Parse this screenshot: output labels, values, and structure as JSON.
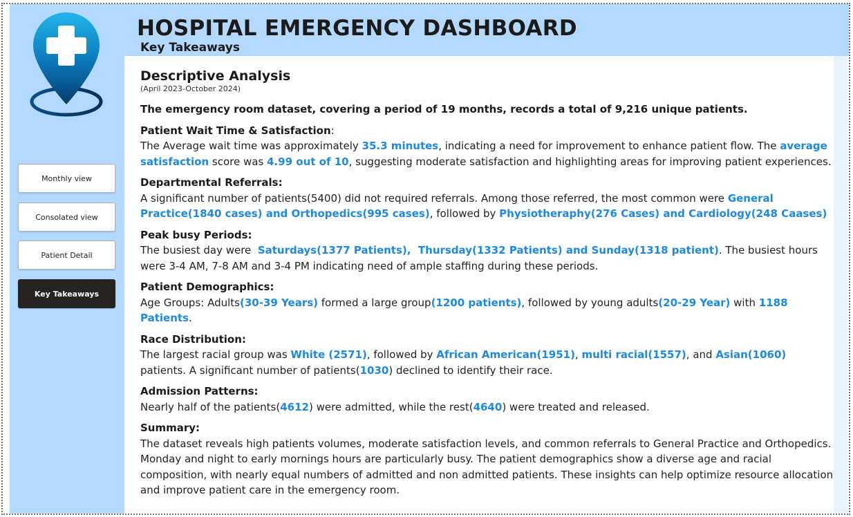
{
  "header": {
    "title": "HOSPITAL EMERGENCY DASHBOARD",
    "subtitle": "Key Takeaways"
  },
  "nav": {
    "monthly": "Monthly view",
    "consolated": "Consolated view",
    "patient_detail": "Patient Detail",
    "key_takeaways": "Key Takeaways"
  },
  "colors": {
    "sidebar_bg": "#b3d9ff",
    "highlight": "#1e88e5",
    "active_button": "#252423"
  },
  "logo": {
    "icon": "medical-location-pin-icon"
  },
  "content": {
    "heading": "Descriptive Analysis",
    "period": "(April 2023-October 2024)",
    "intro": "The emergency room dataset, covering a period of 19 months, records a total of 9,216 unique patients.",
    "wait": {
      "title": "Patient Wait Time & Satisfaction",
      "colon": ":",
      "t1": "The Average wait time was approximately ",
      "h1": "35.3 minutes",
      "t2": ", indicating a need for improvement to enhance patient flow. The ",
      "h2": "average satisfaction",
      "t3": " score was ",
      "h3": "4.99 out of 10",
      "t4": ", suggesting moderate satisfaction and highlighting areas for improving patient experiences."
    },
    "referrals": {
      "title": "Departmental Referrals:",
      "t1": "A significant number of patients(5400) did not required referrals. Among those referred, the most common were ",
      "h1": "General Practice(1840 cases) and Orthopedics(995 cases)",
      "t2": ", followed by ",
      "h2": "Physiotheraphy(276 Cases) and Cardiology(248 Caases)"
    },
    "peak": {
      "title": "Peak busy Periods:",
      "t1": "The busiest day were  ",
      "h1": "Saturdays(1377 Patients),  Thursday(1332 Patients) and Sunday(1318 patient)",
      "t2": ". The busiest hours were 3-4 AM, 7-8 AM and 3-4 PM indicating need of ample staffing during these periods."
    },
    "demographics": {
      "title": "Patient Demographics:",
      "t1": "Age Groups: Adults",
      "h1": "(30-39 Years)",
      "t2": " formed a large group",
      "h2": "(1200 patients)",
      "t3": ", followed by young adults",
      "h3": "(20-29 Year)",
      "t4": " with ",
      "h4": "1188 Patients",
      "t5": "."
    },
    "race": {
      "title": "Race Distribution:",
      "t1": "The largest racial group was ",
      "h1": "White (2571)",
      "t2": ", followed by ",
      "h2": "African American(1951)",
      "t3": ", ",
      "h3": "multi racial(1557)",
      "t4": ", and ",
      "h4": "Asian(1060)",
      "t5": " patients. A significant number of patients(",
      "h5": "1030",
      "t6": ") declined to identify their race."
    },
    "admission": {
      "title": "Admission Patterns:",
      "t1": "Nearly half of the patients(",
      "h1": "4612",
      "t2": ") were admitted, while the rest(",
      "h2": "4640",
      "t3": ") were treated and released."
    },
    "summary": {
      "title": "Summary:",
      "text": "The dataset reveals high patients volumes, moderate satisfaction levels, and common referrals to General Practice and Orthopedics. Monday and night to early mornings hours are particularly busy. The patient demographics show a diverse age and racial composition, with nearly equal numbers of admitted and non admitted patients. These insights can help optimize resource allocation and improve patient care in the emergency room."
    }
  }
}
